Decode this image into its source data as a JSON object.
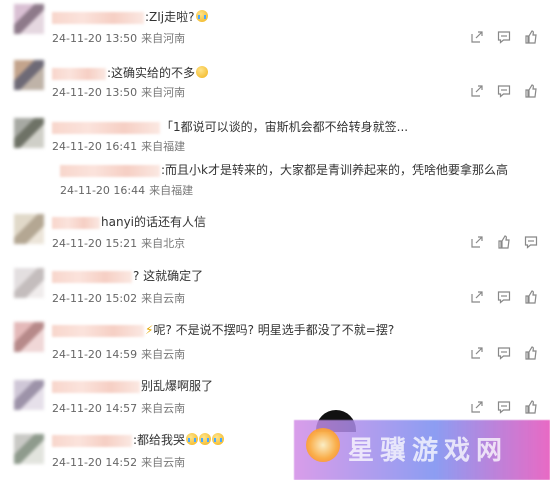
{
  "comments": [
    {
      "text": ":ZIj走啦?",
      "emoji": "cry",
      "time": "24-11-20 13:50",
      "location": "来自河南",
      "actions": true
    },
    {
      "text": ":这确实给的不多",
      "emoji": "smile",
      "time": "24-11-20 13:50",
      "location": "来自河南",
      "actions": true
    },
    {
      "text": "「1都说可以谈的，宙斯机会都不给转身就签...",
      "emoji": "",
      "time": "24-11-20 16:41",
      "location": "来自福建",
      "actions": false
    },
    {
      "text": "hanyi的话还有人信",
      "emoji": "",
      "time": "24-11-20 15:21",
      "location": "来自北京",
      "actions": true
    },
    {
      "text": "? 这就确定了",
      "emoji": "",
      "time": "24-11-20 15:02",
      "location": "来自云南",
      "actions": true
    },
    {
      "text": "呢? 不是说不摆吗? 明星选手都没了不就=摆?",
      "emoji": "",
      "time": "24-11-20 14:59",
      "location": "来自云南",
      "actions": true
    },
    {
      "text": "别乱爆啊服了",
      "emoji": "",
      "time": "24-11-20 14:57",
      "location": "来自云南",
      "actions": true
    },
    {
      "text": ":都给我哭",
      "emoji": "cry3",
      "time": "24-11-20 14:52",
      "location": "来自云南",
      "actions": false
    }
  ],
  "reply": {
    "text": ":而且小k才是转来的，大家都是青训养起来的，凭啥他要拿那么高",
    "time": "24-11-20 16:44",
    "location": "来自福建"
  },
  "watermark": {
    "text": "星骥游戏网"
  }
}
